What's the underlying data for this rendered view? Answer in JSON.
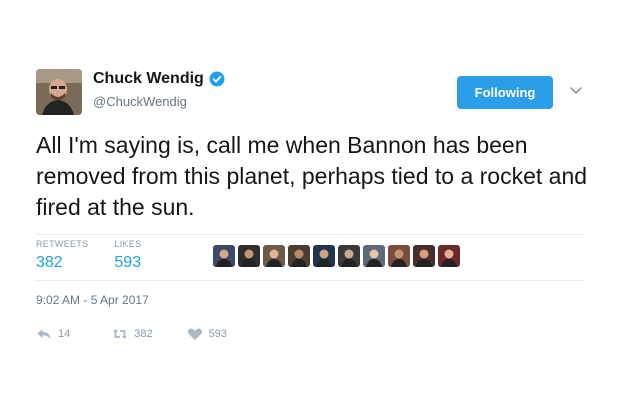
{
  "author": {
    "display_name": "Chuck Wendig",
    "handle": "@ChuckWendig",
    "verified_icon": "verified-badge-icon"
  },
  "follow_button_label": "Following",
  "tweet_text": "All I'm saying is, call me when Bannon has been removed from this planet, perhaps tied to a rocket and fired at the sun.",
  "stats": {
    "retweets_label": "RETWEETS",
    "retweets_value": "382",
    "likes_label": "LIKES",
    "likes_value": "593"
  },
  "likers_count": 10,
  "timestamp": "9:02 AM - 5 Apr 2017",
  "actions": {
    "reply_count": "14",
    "retweet_count": "382",
    "like_count": "593"
  },
  "colors": {
    "accent": "#1da1f2",
    "follow_bg": "#2b9de9",
    "muted": "#8899a6"
  }
}
